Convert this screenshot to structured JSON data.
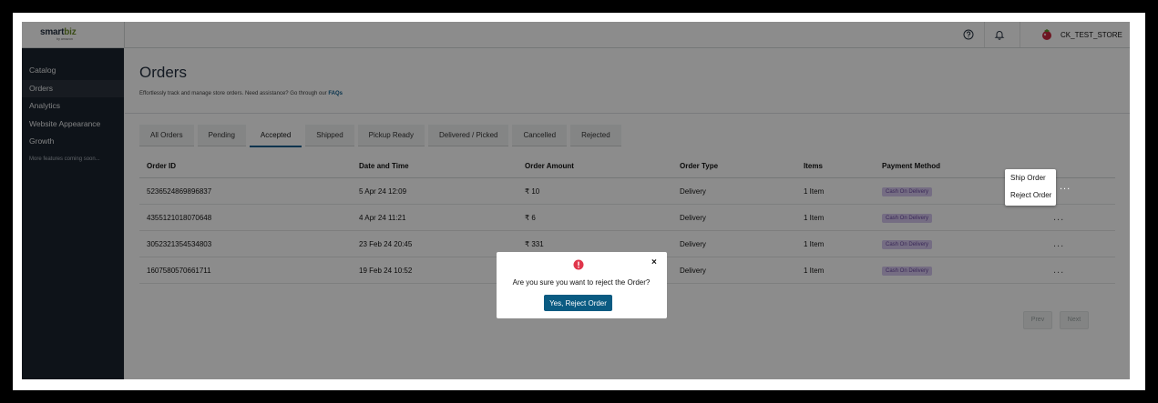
{
  "brand": {
    "logo_main": "smart",
    "logo_accent": "biz",
    "logo_sub": "by amazon"
  },
  "header": {
    "store_name": "CK_TEST_STORE"
  },
  "sidebar": {
    "items": [
      {
        "label": "Catalog"
      },
      {
        "label": "Orders"
      },
      {
        "label": "Analytics"
      },
      {
        "label": "Website Appearance"
      },
      {
        "label": "Growth"
      }
    ],
    "note": "More features coming soon..."
  },
  "page": {
    "title": "Orders",
    "subtitle": "Effortlessly track and manage store orders. Need assistance? Go through our",
    "faq_link": "FAQs"
  },
  "tabs": [
    {
      "label": "All Orders"
    },
    {
      "label": "Pending"
    },
    {
      "label": "Accepted"
    },
    {
      "label": "Shipped"
    },
    {
      "label": "Pickup Ready"
    },
    {
      "label": "Delivered / Picked"
    },
    {
      "label": "Cancelled"
    },
    {
      "label": "Rejected"
    }
  ],
  "active_tab": "Accepted",
  "table": {
    "headers": [
      "Order ID",
      "Date and Time",
      "Order Amount",
      "Order Type",
      "Items",
      "Payment Method"
    ],
    "rows": [
      {
        "id": "5236524869896837",
        "date": "5 Apr 24 12:09",
        "amount": "₹ 10",
        "type": "Delivery",
        "items": "1 Item",
        "payment": "Cash On Delivery"
      },
      {
        "id": "4355121018070648",
        "date": "4 Apr 24 11:21",
        "amount": "₹ 6",
        "type": "Delivery",
        "items": "1 Item",
        "payment": "Cash On Delivery"
      },
      {
        "id": "3052321354534803",
        "date": "23 Feb 24 20:45",
        "amount": "₹ 331",
        "type": "Delivery",
        "items": "1 Item",
        "payment": "Cash On Delivery"
      },
      {
        "id": "1607580570661711",
        "date": "19 Feb 24 10:52",
        "amount": "",
        "type": "Delivery",
        "items": "1 Item",
        "payment": "Cash On Delivery"
      }
    ],
    "row_menu_glyph": "..."
  },
  "pagination": {
    "prev": "Prev",
    "next": "Next"
  },
  "context_menu": {
    "items": [
      "Ship Order",
      "Reject Order"
    ]
  },
  "modal": {
    "message": "Are you sure you want to reject the Order?",
    "confirm": "Yes, Reject Order",
    "close_glyph": "×"
  },
  "colors": {
    "accent": "#0a5b82",
    "sidebar": "#1b232e",
    "badge_bg": "#d6c7ef",
    "warning": "#e0364b"
  }
}
